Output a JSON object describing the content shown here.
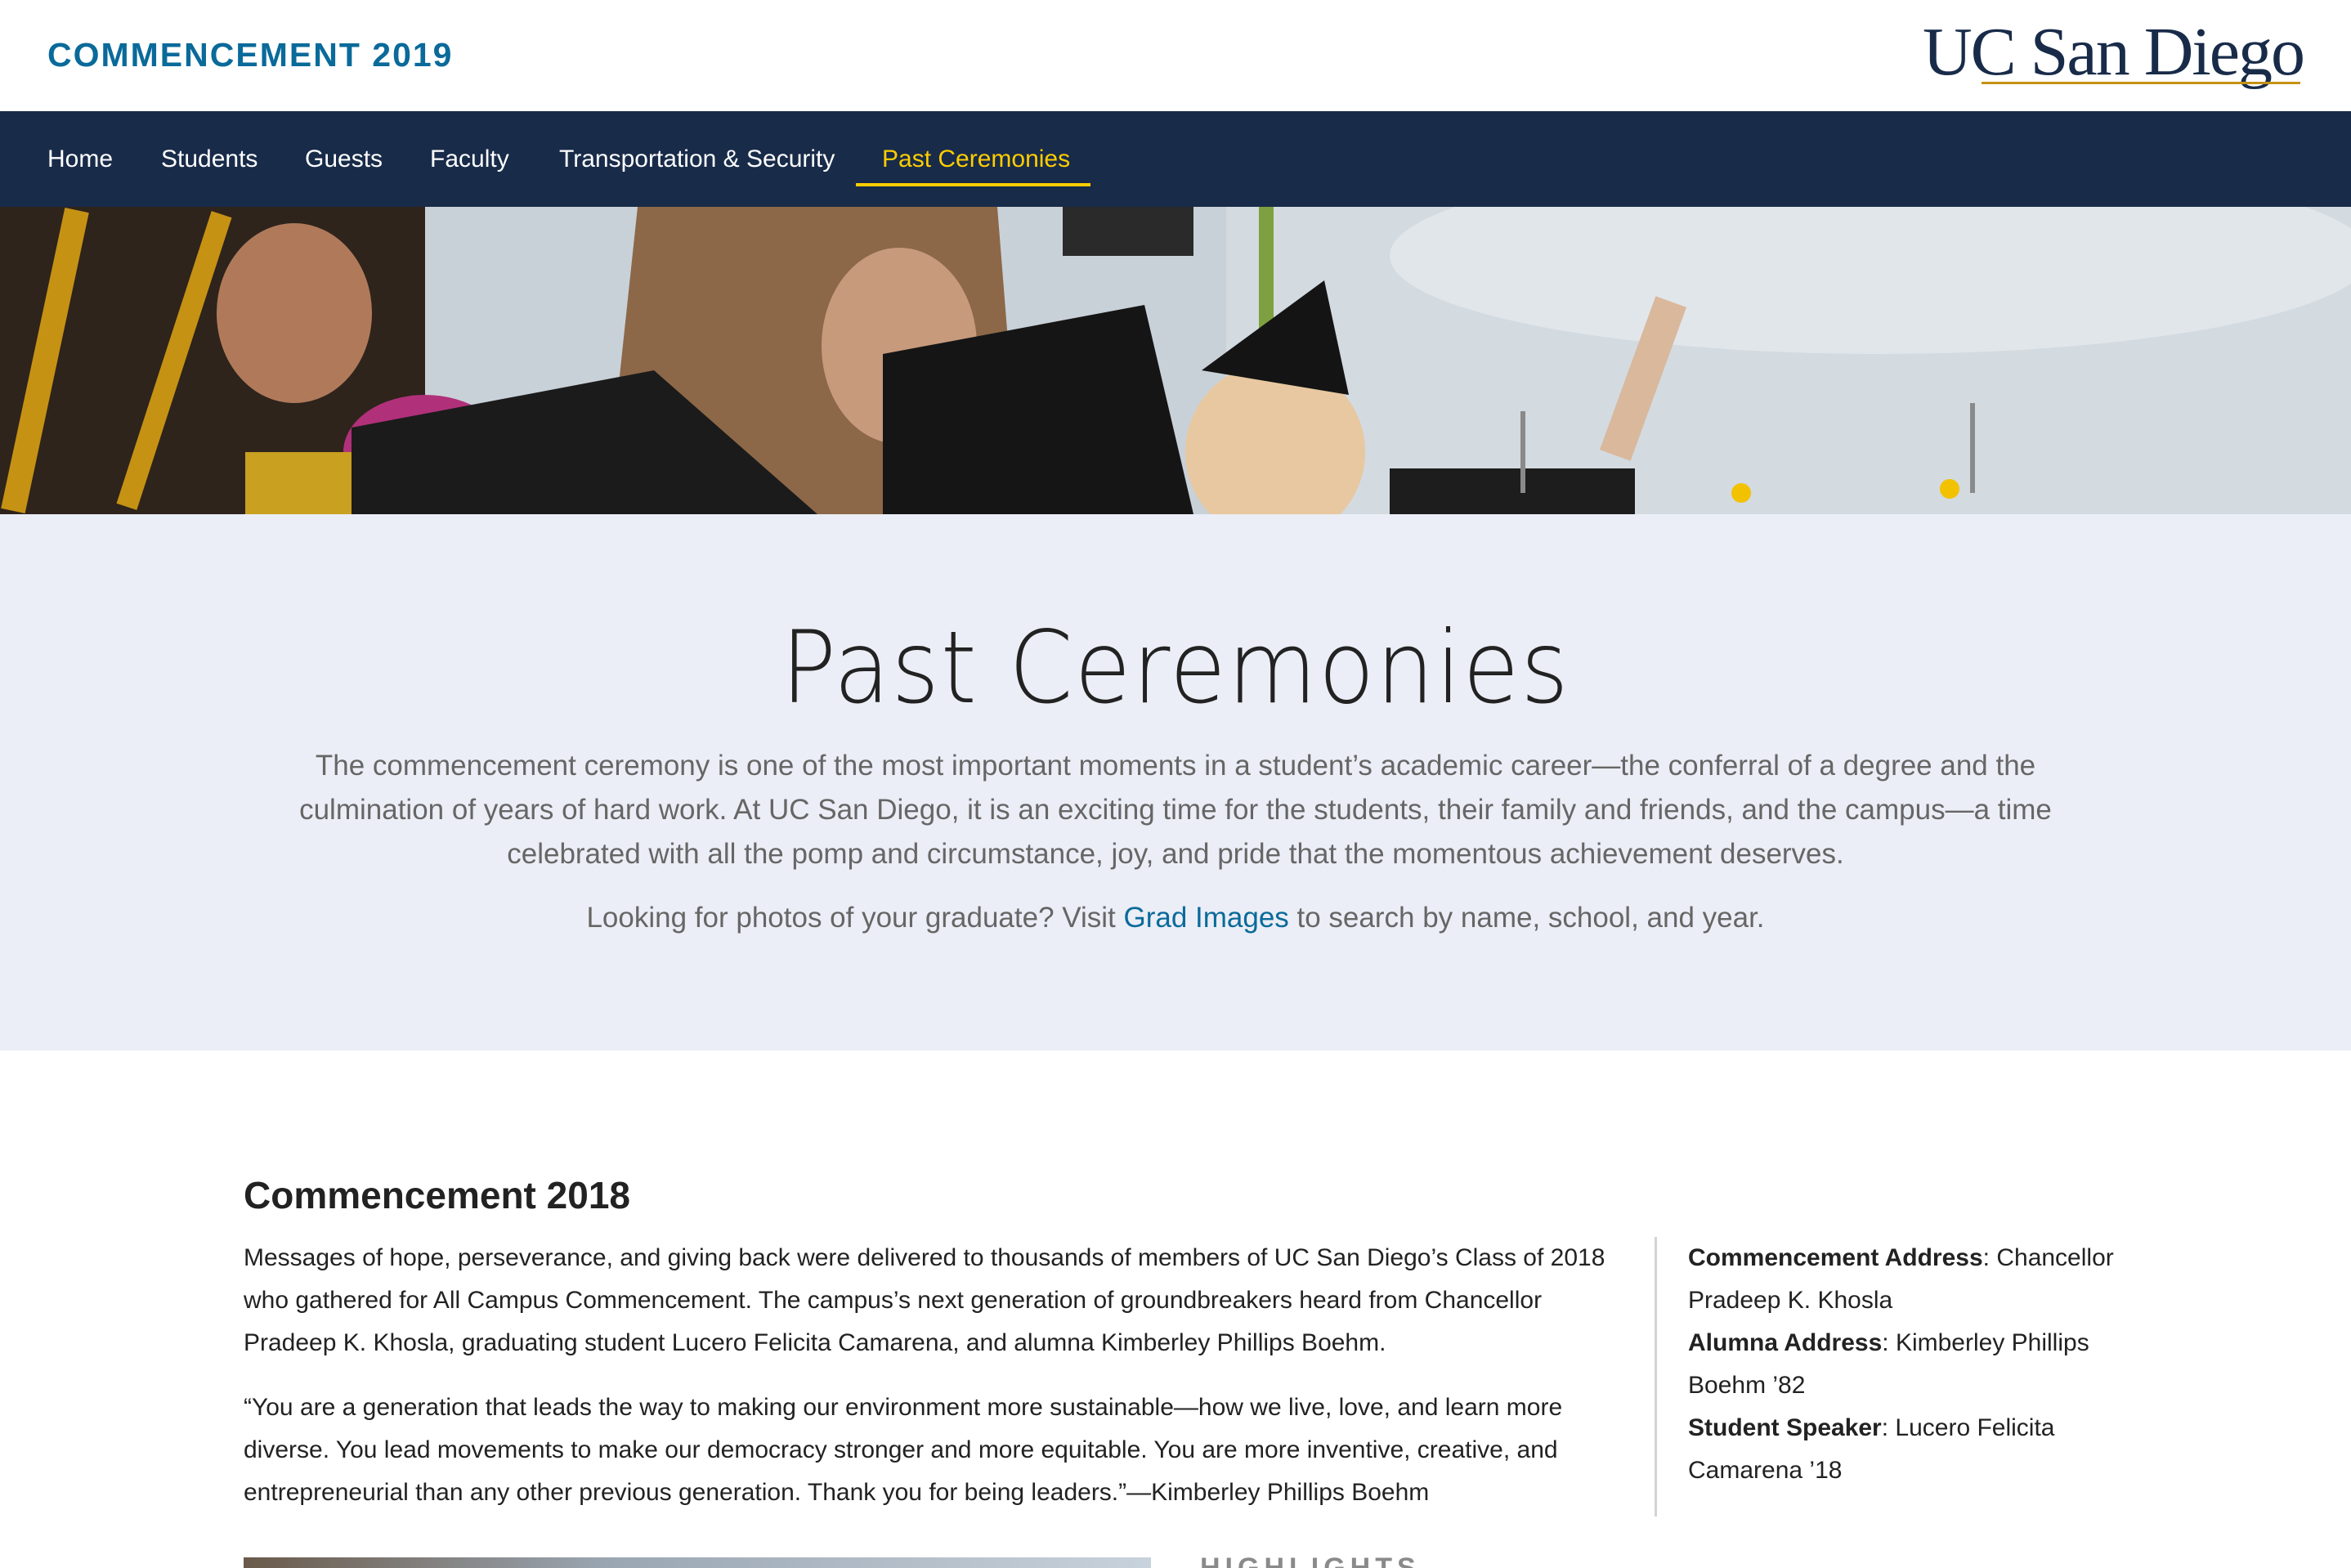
{
  "header": {
    "site_title": "COMMENCEMENT 2019",
    "logo_text": "UC San Diego"
  },
  "nav": {
    "items": [
      {
        "label": "Home"
      },
      {
        "label": "Students"
      },
      {
        "label": "Guests"
      },
      {
        "label": "Faculty"
      },
      {
        "label": "Transportation & Security"
      },
      {
        "label": "Past Ceremonies",
        "active": true
      }
    ]
  },
  "intro": {
    "title": "Past Ceremonies",
    "description": "The commencement ceremony is one of the most important moments in a student’s academic career—the conferral of a degree and the culmination of years of hard work. At UC San Diego, it is an exciting time for the students, their family and friends, and the campus—a time celebrated with all the pomp and circumstance, joy, and pride that the momentous achievement deserves.",
    "photos_prefix": "Looking for photos of your graduate? Visit ",
    "photos_link": "Grad Images",
    "photos_suffix": " to search by name, school, and year."
  },
  "section_2018": {
    "title": "Commencement 2018",
    "paragraph1": "Messages of hope, perseverance, and giving back were delivered to thousands of members of UC San Diego’s Class of 2018 who gathered for All Campus Commencement. The campus’s next generation of groundbreakers heard from Chancellor Pradeep K. Khosla, graduating student Lucero Felicita Camarena, and alumna Kimberley Phillips Boehm.",
    "paragraph2": "“You are a generation that leads the way to making our environment more sustainable—how we live, love, and learn more diverse. You lead movements to make our democracy stronger and more equitable. You are more inventive, creative, and entrepreneurial than any other previous generation. Thank you for being leaders.”—Kimberley Phillips Boehm",
    "sidebar": [
      {
        "label": "Commencement Address",
        "value": ": Chancellor Pradeep K. Khosla"
      },
      {
        "label": "Alumna Address",
        "value": ": Kimberley Phillips Boehm ’82"
      },
      {
        "label": "Student Speaker",
        "value": ": Lucero Felicita Camarena ’18"
      }
    ],
    "highlights_label": "HIGHLIGHTS"
  },
  "colors": {
    "brand_navy": "#182b49",
    "brand_blue": "#0a6a9a",
    "brand_gold": "#ffcd00",
    "intro_bg": "#ebeef6"
  }
}
